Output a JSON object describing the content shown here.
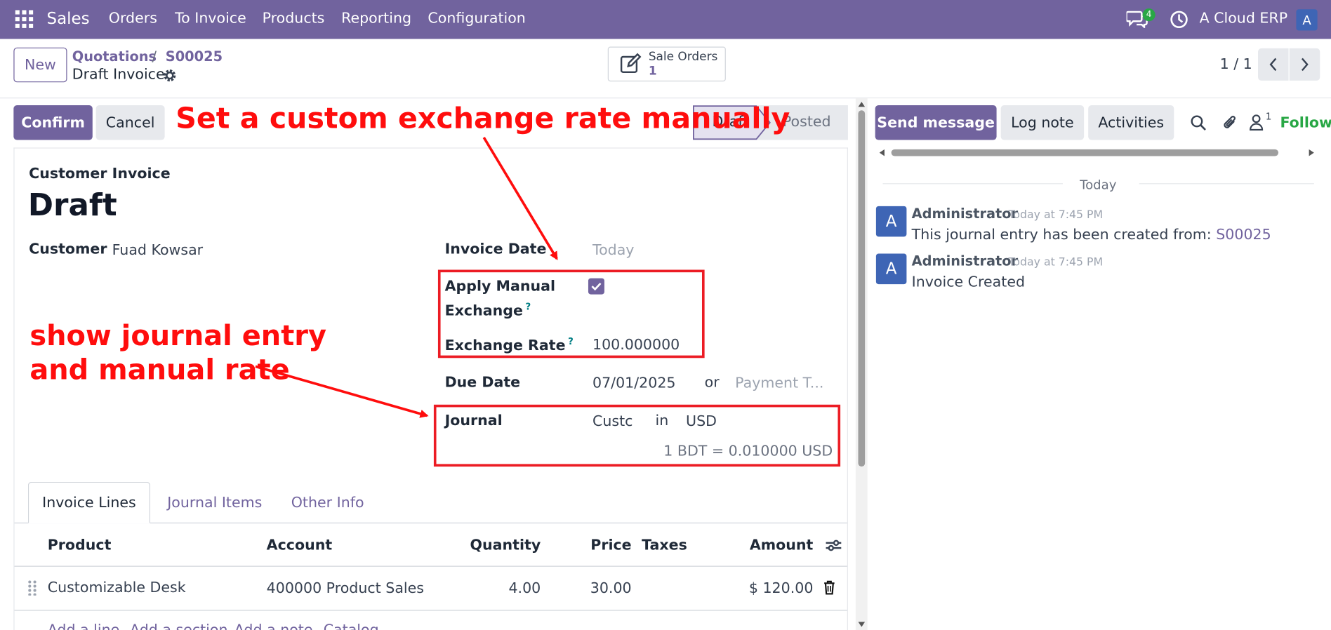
{
  "navbar": {
    "app_name": "Sales",
    "menu": [
      "Orders",
      "To Invoice",
      "Products",
      "Reporting",
      "Configuration"
    ],
    "messages_count": "4",
    "company": "A Cloud ERP",
    "user_initial": "A",
    "colors": {
      "navbar": "#71639e",
      "badge": "#28a745"
    }
  },
  "control_panel": {
    "new_label": "New",
    "breadcrumb": [
      "Quotations",
      "S00025"
    ],
    "breadcrumb_sep": "/",
    "record_title": "Draft Invoice",
    "smart_button": {
      "label": "Sale Orders",
      "count": "1"
    },
    "pager": "1 / 1"
  },
  "statusbar": {
    "confirm_label": "Confirm",
    "cancel_label": "Cancel",
    "stages": [
      "Draft",
      "Posted"
    ],
    "active_stage": "Draft"
  },
  "form": {
    "move_type": "Customer Invoice",
    "state_title": "Draft",
    "customer_label": "Customer",
    "customer_value": "Fuad Kowsar",
    "invoice_date_label": "Invoice Date",
    "invoice_date_placeholder": "Today",
    "apply_manual_label_1": "Apply Manual",
    "apply_manual_label_2": "Exchange",
    "apply_manual_checked": true,
    "exchange_rate_label": "Exchange Rate",
    "exchange_rate_value": "100.000000",
    "help_mark": "?",
    "due_date_label": "Due Date",
    "due_date_value": "07/01/2025",
    "or_text": "or",
    "payment_terms_placeholder": "Payment T...",
    "journal_label": "Journal",
    "journal_value": "Custc",
    "in_text": "in",
    "currency": "USD",
    "rate_text": "1 BDT = 0.010000 USD"
  },
  "tabs": [
    "Invoice Lines",
    "Journal Items",
    "Other Info"
  ],
  "lines": {
    "headers": {
      "product": "Product",
      "account": "Account",
      "quantity": "Quantity",
      "price": "Price",
      "taxes": "Taxes",
      "amount": "Amount"
    },
    "rows": [
      {
        "product": "Customizable Desk",
        "account": "400000 Product Sales",
        "quantity": "4.00",
        "price": "30.00",
        "taxes": "",
        "amount": "$ 120.00"
      }
    ],
    "add_links": [
      "Add a line",
      "Add a section",
      "Add a note",
      "Catalog"
    ]
  },
  "chatter": {
    "send_message": "Send message",
    "log_note": "Log note",
    "activities": "Activities",
    "followers_count": "1",
    "follow_label": "Follow",
    "date_separator": "Today",
    "messages": [
      {
        "author": "Administrator",
        "time": "Today at 7:45 PM",
        "body": "This journal entry has been created from: ",
        "link": "S00025",
        "initial": "A"
      },
      {
        "author": "Administrator",
        "time": "Today at 7:45 PM",
        "body": "Invoice Created",
        "link": "",
        "initial": "A"
      }
    ]
  },
  "annotations": {
    "top_note": "Set a custom exchange rate manually",
    "left_note_line1": "show journal entry",
    "left_note_line2": "and manual rate",
    "color": "#ff0d0d"
  }
}
